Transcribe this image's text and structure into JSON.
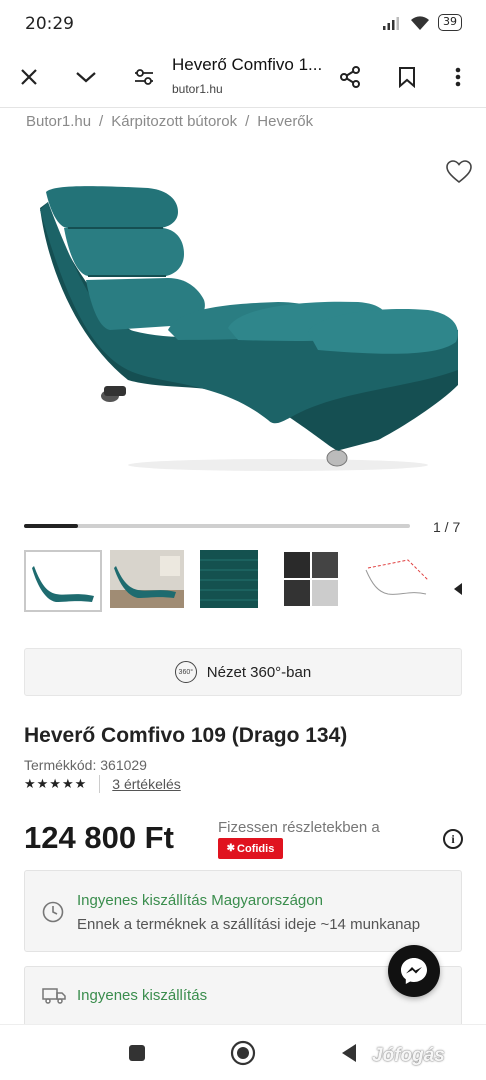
{
  "status_bar": {
    "time": "20:29",
    "battery": "39",
    "icons": [
      "signal-icon",
      "wifi-icon",
      "battery-icon"
    ]
  },
  "browser": {
    "title": "Heverő Comfivo 1...",
    "url": "butor1.hu",
    "icons": [
      "close-icon",
      "chevron-down-icon",
      "tune-icon",
      "share-icon",
      "bookmark-icon",
      "more-vert-icon"
    ]
  },
  "breadcrumb": {
    "items": [
      "Butor1.hu",
      "Kárpitozott bútorok",
      "Heverők"
    ],
    "separator": "/"
  },
  "gallery": {
    "counter": "1 / 7",
    "progress": 0.14,
    "thumbnails": 5
  },
  "view360": {
    "label": "Nézet 360°-ban",
    "badge": "360°"
  },
  "product": {
    "title": "Heverő Comfivo 109 (Drago 134)",
    "code": "Termékkód: 361029",
    "stars": "★★★★★",
    "reviews": "3 értékelés",
    "price": "124 800 Ft",
    "installment": "Fizessen részletekben a",
    "cofidis": "Cofidis"
  },
  "shipping": {
    "free_delivery_title": "Ingyenes kiszállítás Magyarországon",
    "delivery_time": "Ennek a terméknek a szállítási ideje ~14 munkanap",
    "free_delivery2": "Ingyenes kiszállítás"
  },
  "watermark": "Jófogás",
  "colors": {
    "accent_green": "#3a8d4d",
    "cofidis_red": "#e0131f",
    "sofa_teal": "#1e6b6f"
  }
}
